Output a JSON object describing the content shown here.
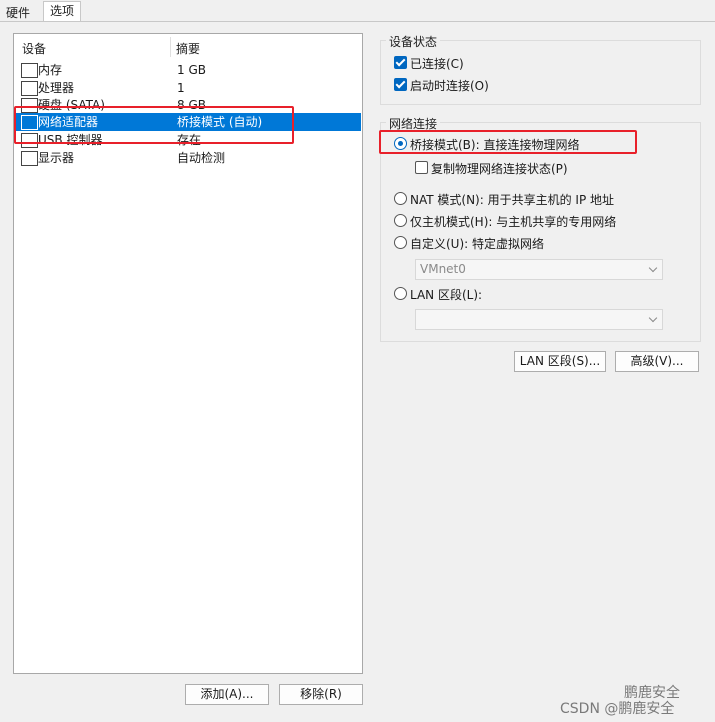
{
  "tabs": {
    "hardware": "硬件",
    "options": "选项"
  },
  "device_list": {
    "col_device": "设备",
    "col_summary": "摘要",
    "rows": [
      {
        "icon": "memory-icon",
        "name": "内存",
        "summary": "1 GB"
      },
      {
        "icon": "cpu-icon",
        "name": "处理器",
        "summary": "1"
      },
      {
        "icon": "hard-disk-icon",
        "name": "硬盘 (SATA)",
        "summary": "8 GB"
      },
      {
        "icon": "network-adapter-icon",
        "name": "网络适配器",
        "summary": "桥接模式 (自动)",
        "selected": true
      },
      {
        "icon": "usb-icon",
        "name": "USB 控制器",
        "summary": "存在"
      },
      {
        "icon": "monitor-icon",
        "name": "显示器",
        "summary": "自动检测"
      }
    ]
  },
  "buttons": {
    "add": "添加(A)...",
    "remove": "移除(R)",
    "lan_segments": "LAN 区段(S)...",
    "advanced": "高级(V)..."
  },
  "device_status": {
    "title": "设备状态",
    "connected": {
      "label": "已连接(C)",
      "checked": true
    },
    "connect_at_power_on": {
      "label": "启动时连接(O)",
      "checked": true
    }
  },
  "network_connection": {
    "title": "网络连接",
    "bridged": {
      "label": "桥接模式(B): 直接连接物理网络",
      "selected": true
    },
    "replicate": {
      "label": "复制物理网络连接状态(P)",
      "checked": false
    },
    "nat": {
      "label": "NAT 模式(N): 用于共享主机的 IP 地址",
      "selected": false
    },
    "host_only": {
      "label": "仅主机模式(H): 与主机共享的专用网络",
      "selected": false
    },
    "custom": {
      "label": "自定义(U): 特定虚拟网络",
      "selected": false
    },
    "custom_select": "VMnet0",
    "lan_segment": {
      "label": "LAN 区段(L):",
      "selected": false
    },
    "lan_select": ""
  },
  "watermark": {
    "brand": "鹏鹿安全",
    "csdn": "CSDN @鹏鹿安全"
  },
  "colors": {
    "selection": "#0078d7",
    "accent": "#0067c0",
    "highlight": "#e8202a"
  }
}
